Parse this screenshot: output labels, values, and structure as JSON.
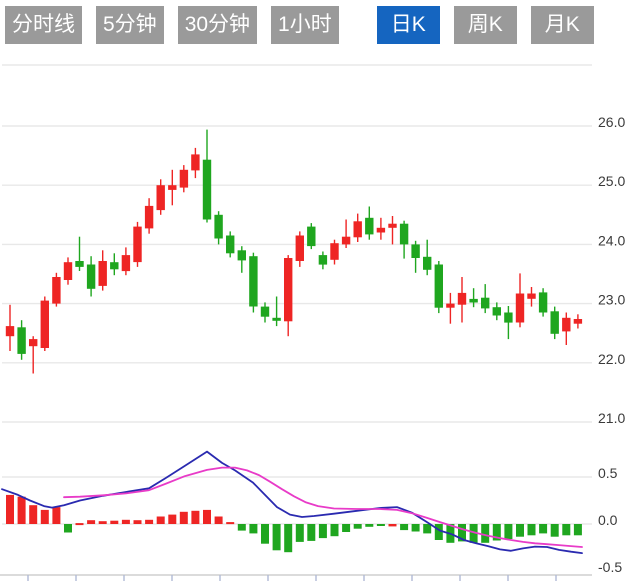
{
  "tabs": [
    {
      "label": "分时线",
      "active": false
    },
    {
      "label": "5分钟",
      "active": false
    },
    {
      "label": "30分钟",
      "active": false
    },
    {
      "label": "1小时",
      "active": false
    },
    {
      "label": "日K",
      "active": true
    },
    {
      "label": "周K",
      "active": false
    },
    {
      "label": "月K",
      "active": false
    }
  ],
  "colors": {
    "tab_bg": "#9a9a9a",
    "tab_active_bg": "#1565c0",
    "tab_text": "#ffffff",
    "up": "#ee2524",
    "down": "#1fa61f",
    "dif_line": "#2a2ab0",
    "dea_line": "#e83bc8",
    "grid": "#e8e8e8",
    "axis_label": "#3a3a3a",
    "axis_line": "#cfcfcf",
    "axis_tick": "#b0bad6"
  },
  "chart_data": [
    {
      "type": "candlestick",
      "pane": "price",
      "grid": true,
      "legend": "none",
      "y_ticks": [
        "26.0",
        "25.0",
        "24.0",
        "23.0",
        "22.0",
        "21.0"
      ],
      "y_tick_values": [
        26.0,
        25.0,
        24.0,
        23.0,
        22.0,
        21.0
      ],
      "y_range": [
        20.9,
        27.0
      ],
      "candles_ohlc": [
        [
          22.45,
          22.98,
          22.2,
          22.62
        ],
        [
          22.6,
          22.72,
          22.05,
          22.15
        ],
        [
          22.28,
          22.45,
          21.82,
          22.4
        ],
        [
          22.25,
          23.12,
          22.2,
          23.05
        ],
        [
          23.0,
          23.52,
          22.95,
          23.45
        ],
        [
          23.4,
          23.78,
          23.32,
          23.7
        ],
        [
          23.72,
          24.13,
          23.55,
          23.62
        ],
        [
          23.66,
          23.8,
          23.12,
          23.25
        ],
        [
          23.3,
          23.9,
          23.22,
          23.72
        ],
        [
          23.7,
          23.85,
          23.48,
          23.58
        ],
        [
          23.55,
          23.95,
          23.48,
          23.82
        ],
        [
          23.7,
          24.38,
          23.62,
          24.3
        ],
        [
          24.27,
          24.78,
          24.18,
          24.65
        ],
        [
          24.58,
          25.1,
          24.5,
          25.0
        ],
        [
          24.92,
          25.26,
          24.66,
          25.0
        ],
        [
          24.96,
          25.34,
          24.88,
          25.26
        ],
        [
          25.25,
          25.63,
          25.12,
          25.52
        ],
        [
          25.43,
          25.94,
          24.37,
          24.42
        ],
        [
          24.5,
          24.56,
          24.0,
          24.1
        ],
        [
          24.15,
          24.22,
          23.78,
          23.85
        ],
        [
          23.9,
          23.97,
          23.52,
          23.73
        ],
        [
          23.8,
          23.86,
          22.85,
          22.95
        ],
        [
          22.95,
          23.02,
          22.68,
          22.78
        ],
        [
          22.76,
          23.12,
          22.62,
          22.71
        ],
        [
          22.7,
          23.82,
          22.45,
          23.77
        ],
        [
          23.72,
          24.22,
          23.62,
          24.15
        ],
        [
          24.3,
          24.36,
          23.92,
          23.97
        ],
        [
          23.82,
          23.88,
          23.58,
          23.66
        ],
        [
          23.74,
          24.08,
          23.66,
          24.02
        ],
        [
          24.0,
          24.42,
          23.94,
          24.13
        ],
        [
          24.12,
          24.52,
          24.04,
          24.39
        ],
        [
          24.45,
          24.64,
          24.08,
          24.17
        ],
        [
          24.2,
          24.45,
          24.08,
          24.28
        ],
        [
          24.28,
          24.48,
          24.0,
          24.35
        ],
        [
          24.35,
          24.4,
          23.76,
          24.0
        ],
        [
          24.0,
          24.06,
          23.52,
          23.77
        ],
        [
          23.79,
          24.08,
          23.48,
          23.57
        ],
        [
          23.66,
          23.72,
          22.84,
          22.93
        ],
        [
          22.93,
          23.18,
          22.66,
          23.0
        ],
        [
          22.98,
          23.45,
          22.68,
          23.18
        ],
        [
          23.08,
          23.26,
          22.94,
          23.02
        ],
        [
          23.1,
          23.33,
          22.84,
          22.92
        ],
        [
          22.94,
          23.02,
          22.72,
          22.8
        ],
        [
          22.85,
          22.96,
          22.4,
          22.68
        ],
        [
          22.68,
          23.51,
          22.6,
          23.17
        ],
        [
          23.08,
          23.28,
          22.95,
          23.17
        ],
        [
          23.19,
          23.26,
          22.78,
          22.85
        ],
        [
          22.87,
          22.95,
          22.4,
          22.49
        ],
        [
          22.53,
          22.85,
          22.3,
          22.76
        ],
        [
          22.66,
          22.82,
          22.58,
          22.74
        ]
      ]
    },
    {
      "type": "bar",
      "pane": "macd",
      "grid": true,
      "y_ticks": [
        "0.5",
        "0.0",
        "-0.5"
      ],
      "y_tick_values": [
        0.5,
        0.0,
        -0.5
      ],
      "y_range": [
        -0.6,
        1.0
      ],
      "histogram": [
        0.31,
        0.29,
        0.2,
        0.15,
        0.18,
        -0.09,
        0.01,
        0.04,
        0.03,
        0.035,
        0.045,
        0.04,
        0.045,
        0.08,
        0.1,
        0.13,
        0.14,
        0.15,
        0.08,
        0.02,
        -0.07,
        -0.1,
        -0.21,
        -0.28,
        -0.3,
        -0.19,
        -0.18,
        -0.15,
        -0.13,
        -0.085,
        -0.05,
        -0.03,
        -0.02,
        -0.025,
        -0.065,
        -0.08,
        -0.1,
        -0.17,
        -0.2,
        -0.185,
        -0.2,
        -0.2,
        -0.175,
        -0.16,
        -0.135,
        -0.12,
        -0.1,
        -0.135,
        -0.12,
        -0.12
      ],
      "histogram_colors": [
        "r",
        "r",
        "r",
        "r",
        "r",
        "g",
        "r",
        "r",
        "r",
        "r",
        "r",
        "r",
        "r",
        "r",
        "r",
        "r",
        "r",
        "r",
        "r",
        "r",
        "g",
        "g",
        "g",
        "g",
        "g",
        "g",
        "g",
        "g",
        "g",
        "g",
        "g",
        "g",
        "g",
        "r",
        "g",
        "g",
        "g",
        "g",
        "g",
        "g",
        "g",
        "g",
        "g",
        "g",
        "g",
        "g",
        "g",
        "g",
        "g",
        "g"
      ],
      "dif": [
        [
          2,
          0.37
        ],
        [
          18,
          0.31
        ],
        [
          30,
          0.25
        ],
        [
          44,
          0.19
        ],
        [
          52,
          0.175
        ],
        [
          64,
          0.2
        ],
        [
          80,
          0.25
        ],
        [
          103,
          0.3
        ],
        [
          126,
          0.34
        ],
        [
          149,
          0.38
        ],
        [
          166,
          0.49
        ],
        [
          185,
          0.62
        ],
        [
          207,
          0.77
        ],
        [
          222,
          0.65
        ],
        [
          235,
          0.57
        ],
        [
          253,
          0.44
        ],
        [
          265,
          0.31
        ],
        [
          277,
          0.18
        ],
        [
          290,
          0.1
        ],
        [
          302,
          0.075
        ],
        [
          314,
          0.085
        ],
        [
          334,
          0.11
        ],
        [
          357,
          0.14
        ],
        [
          380,
          0.17
        ],
        [
          397,
          0.18
        ],
        [
          412,
          0.12
        ],
        [
          427,
          0.02
        ],
        [
          440,
          -0.07
        ],
        [
          452,
          -0.11
        ],
        [
          464,
          -0.17
        ],
        [
          476,
          -0.205
        ],
        [
          488,
          -0.235
        ],
        [
          500,
          -0.27
        ],
        [
          511,
          -0.285
        ],
        [
          523,
          -0.26
        ],
        [
          535,
          -0.24
        ],
        [
          547,
          -0.245
        ],
        [
          559,
          -0.275
        ],
        [
          571,
          -0.295
        ],
        [
          582,
          -0.31
        ]
      ],
      "dea": [
        [
          64,
          0.285
        ],
        [
          80,
          0.29
        ],
        [
          103,
          0.305
        ],
        [
          126,
          0.325
        ],
        [
          149,
          0.36
        ],
        [
          166,
          0.43
        ],
        [
          185,
          0.51
        ],
        [
          207,
          0.575
        ],
        [
          222,
          0.6
        ],
        [
          235,
          0.6
        ],
        [
          247,
          0.57
        ],
        [
          259,
          0.52
        ],
        [
          270,
          0.45
        ],
        [
          282,
          0.37
        ],
        [
          294,
          0.295
        ],
        [
          306,
          0.23
        ],
        [
          318,
          0.19
        ],
        [
          334,
          0.165
        ],
        [
          357,
          0.16
        ],
        [
          380,
          0.16
        ],
        [
          397,
          0.15
        ],
        [
          412,
          0.115
        ],
        [
          427,
          0.065
        ],
        [
          440,
          0.02
        ],
        [
          452,
          -0.02
        ],
        [
          464,
          -0.06
        ],
        [
          476,
          -0.095
        ],
        [
          488,
          -0.125
        ],
        [
          500,
          -0.15
        ],
        [
          511,
          -0.17
        ],
        [
          523,
          -0.19
        ],
        [
          535,
          -0.205
        ],
        [
          547,
          -0.215
        ],
        [
          559,
          -0.225
        ],
        [
          571,
          -0.235
        ],
        [
          582,
          -0.245
        ]
      ]
    }
  ]
}
